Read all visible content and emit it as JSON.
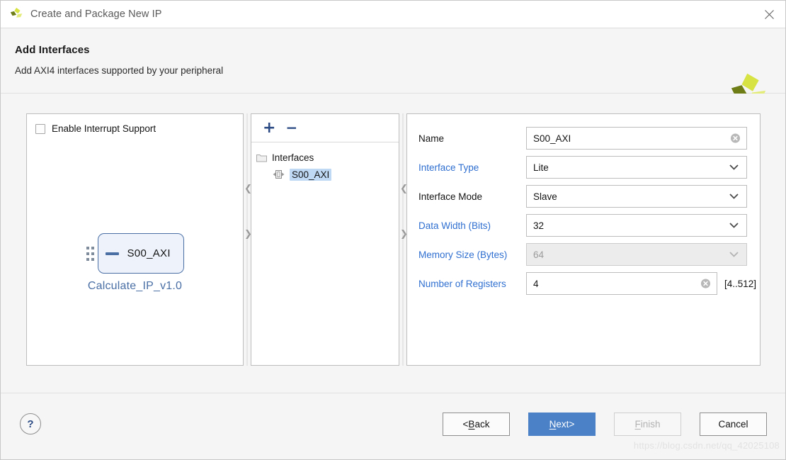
{
  "window": {
    "title": "Create and Package New IP",
    "close_label": "×",
    "logo_icon": "xilinx-logo-icon"
  },
  "header": {
    "title": "Add Interfaces",
    "subtitle": "Add AXI4 interfaces supported by your peripheral",
    "logo_icon": "xilinx-logo-icon"
  },
  "left_panel": {
    "interrupt_checkbox_label": "Enable Interrupt Support",
    "interrupt_checked": false,
    "diagram": {
      "port_label": "S00_AXI",
      "ip_name": "Calculate_IP_v1.0"
    }
  },
  "middle_panel": {
    "toolbar": {
      "add_label": "+",
      "remove_label": "−"
    },
    "tree": {
      "root_label": "Interfaces",
      "root_icon": "folder-icon",
      "items": [
        {
          "label": "S00_AXI",
          "icon": "interface-icon",
          "selected": true
        }
      ]
    }
  },
  "right_panel": {
    "fields": [
      {
        "label": "Name",
        "label_is_link": false,
        "value": "S00_AXI",
        "control": "text",
        "clearable": true,
        "disabled": false
      },
      {
        "label": "Interface Type",
        "label_is_link": true,
        "value": "Lite",
        "control": "dropdown",
        "clearable": false,
        "disabled": false
      },
      {
        "label": "Interface Mode",
        "label_is_link": false,
        "value": "Slave",
        "control": "dropdown",
        "clearable": false,
        "disabled": false
      },
      {
        "label": "Data Width (Bits)",
        "label_is_link": true,
        "value": "32",
        "control": "dropdown",
        "clearable": false,
        "disabled": false
      },
      {
        "label": "Memory Size (Bytes)",
        "label_is_link": true,
        "value": "64",
        "control": "dropdown",
        "clearable": false,
        "disabled": true
      },
      {
        "label": "Number of Registers",
        "label_is_link": true,
        "value": "4",
        "control": "text",
        "clearable": true,
        "disabled": false,
        "range_hint": "[4..512]"
      }
    ]
  },
  "footer": {
    "help_label": "?",
    "buttons": [
      {
        "name": "back",
        "prefix": "< ",
        "accel": "B",
        "rest": "ack",
        "suffix": "",
        "style": "normal"
      },
      {
        "name": "next",
        "prefix": "",
        "accel": "N",
        "rest": "ext",
        "suffix": " >",
        "style": "primary"
      },
      {
        "name": "finish",
        "prefix": "",
        "accel": "F",
        "rest": "inish",
        "suffix": "",
        "style": "disabled"
      },
      {
        "name": "cancel",
        "prefix": "",
        "accel": "",
        "rest": "Cancel",
        "suffix": "",
        "style": "normal"
      }
    ]
  },
  "watermark": "https://blog.csdn.net/qq_42025108",
  "colors": {
    "accent_blue": "#4a81c7",
    "link_blue": "#2f6fd0",
    "selection_blue": "#bfd9f5",
    "diagram_blue": "#4a6fa5",
    "logo_dark": "#6f7d16",
    "logo_bright": "#d6e342",
    "logo_light": "#e3ec7a"
  }
}
